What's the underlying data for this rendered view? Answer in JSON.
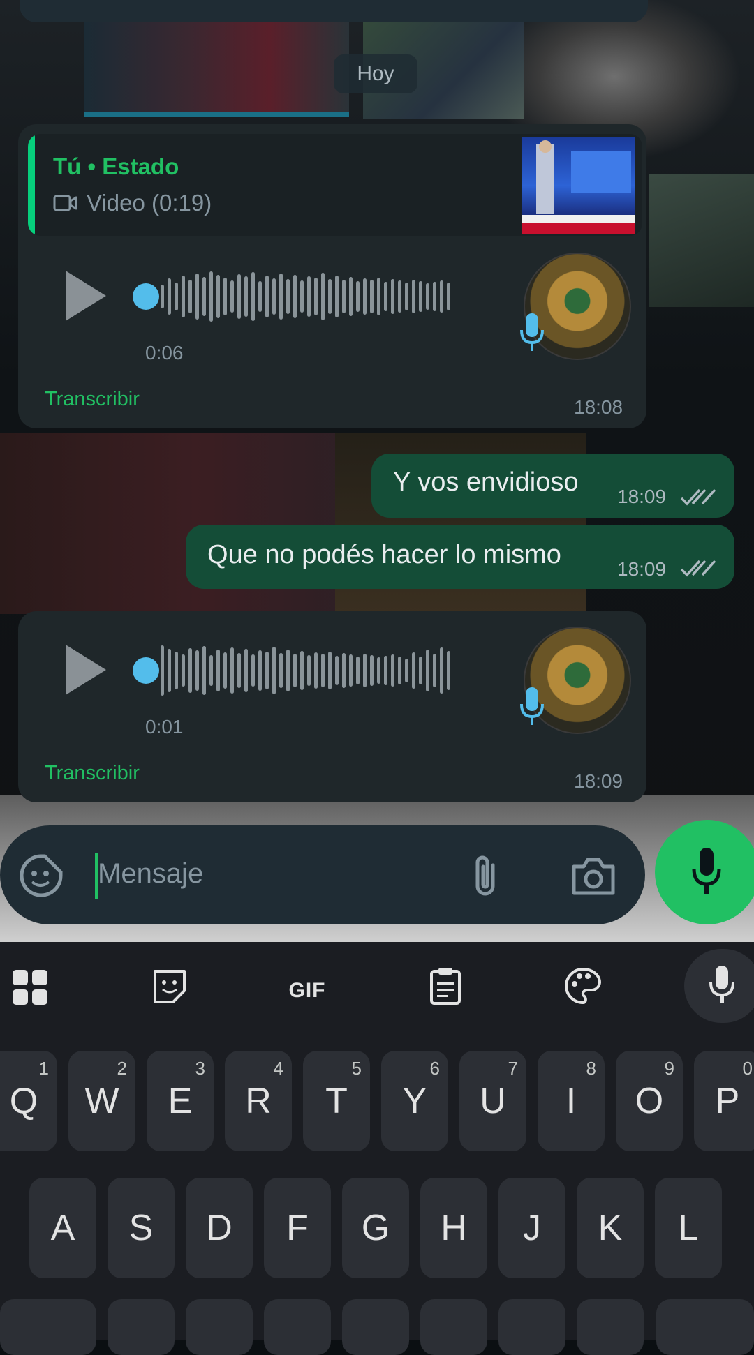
{
  "chat": {
    "date_chip": "Hoy",
    "messages": [
      {
        "type": "voice_in",
        "quote_title": "Tú • Estado",
        "quote_subtitle": "Video (0:19)",
        "duration": "0:06",
        "transcribe": "Transcribir",
        "time": "18:08",
        "progress": 0.0
      },
      {
        "type": "text_out",
        "text": "Y vos envidioso",
        "time": "18:09",
        "status": "read"
      },
      {
        "type": "text_out",
        "text": "Que no podés hacer lo mismo",
        "time": "18:09",
        "status": "read"
      },
      {
        "type": "voice_in",
        "duration": "0:01",
        "transcribe": "Transcribir",
        "time": "18:09",
        "progress": 0.0
      }
    ]
  },
  "composer": {
    "placeholder": "Mensaje",
    "icons": [
      "sticker-icon",
      "attach-icon",
      "camera-icon",
      "mic-icon"
    ]
  },
  "keyboard": {
    "toolbar": [
      "apps-grid-icon",
      "sticker-icon",
      "GIF",
      "clipboard-icon",
      "palette-icon",
      "mic-icon"
    ],
    "gif_label": "GIF",
    "row1": [
      {
        "key": "Q",
        "num": "1"
      },
      {
        "key": "W",
        "num": "2"
      },
      {
        "key": "E",
        "num": "3"
      },
      {
        "key": "R",
        "num": "4"
      },
      {
        "key": "T",
        "num": "5"
      },
      {
        "key": "Y",
        "num": "6"
      },
      {
        "key": "U",
        "num": "7"
      },
      {
        "key": "I",
        "num": "8"
      },
      {
        "key": "O",
        "num": "9"
      },
      {
        "key": "P",
        "num": "0"
      }
    ],
    "row2": [
      "A",
      "S",
      "D",
      "F",
      "G",
      "H",
      "J",
      "K",
      "L"
    ]
  },
  "colors": {
    "accent_green": "#21c063",
    "incoming_bubble": "#1f272a",
    "outgoing_bubble": "#144d37",
    "voice_dot": "#53bdeb"
  }
}
